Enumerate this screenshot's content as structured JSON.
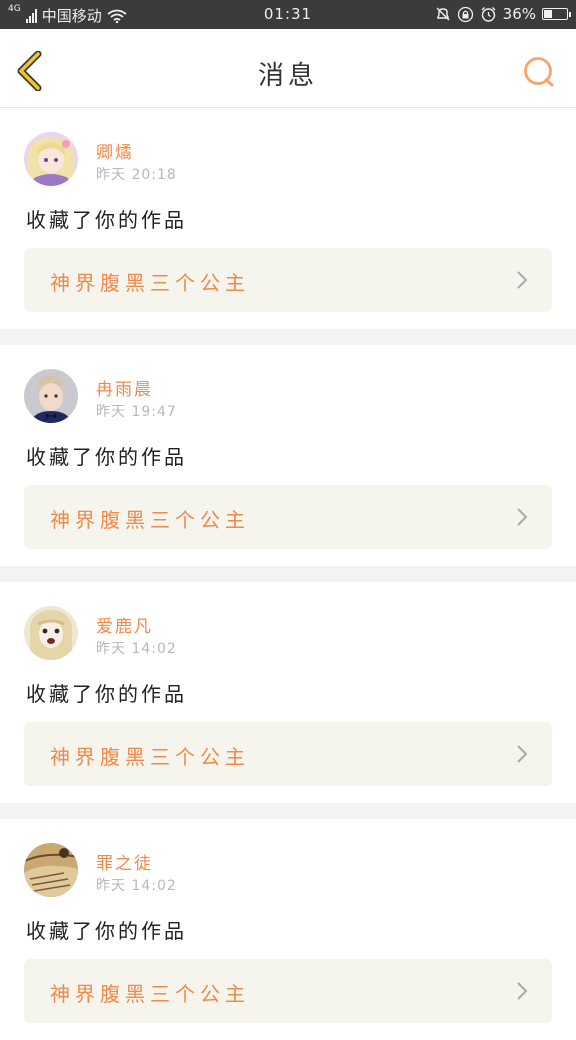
{
  "status_bar": {
    "network": "4G",
    "carrier": "中国移动",
    "time": "01:31",
    "battery": "36%",
    "battery_level": 0.36
  },
  "nav": {
    "title": "消息"
  },
  "colors": {
    "accent": "#f08a4b",
    "back_icon": "#f2c530",
    "card_link_bg": "#f5f5ed",
    "background": "#f3f3f3"
  },
  "messages": [
    {
      "user": "卿燏",
      "time": "昨天 20:18",
      "action": "收藏了你的作品",
      "work": "神界腹黑三个公主",
      "avatar": "anime-girl-avatar"
    },
    {
      "user": "冉雨晨",
      "time": "昨天 19:47",
      "action": "收藏了你的作品",
      "work": "神界腹黑三个公主",
      "avatar": "boy-photo-avatar"
    },
    {
      "user": "爱鹿凡",
      "time": "昨天 14:02",
      "action": "收藏了你的作品",
      "work": "神界腹黑三个公主",
      "avatar": "doll-photo-avatar"
    },
    {
      "user": "罪之徒",
      "time": "昨天 14:02",
      "action": "收藏了你的作品",
      "work": "神界腹黑三个公主",
      "avatar": "brown-photo-avatar"
    }
  ]
}
